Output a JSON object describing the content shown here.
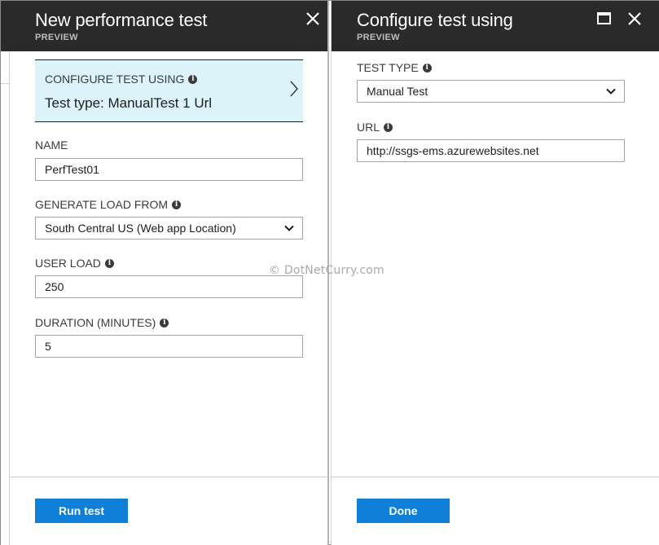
{
  "left_blade": {
    "title": "New performance test",
    "subtitle": "PREVIEW",
    "configure": {
      "label": "CONFIGURE TEST USING",
      "value": "Test type: ManualTest 1 Url"
    },
    "name": {
      "label": "NAME",
      "value": "PerfTest01"
    },
    "load_from": {
      "label": "GENERATE LOAD FROM",
      "value": "South Central US (Web app Location)"
    },
    "user_load": {
      "label": "USER LOAD",
      "value": "250"
    },
    "duration": {
      "label": "DURATION (MINUTES)",
      "value": "5"
    },
    "run_button": "Run test"
  },
  "right_blade": {
    "title": "Configure test using",
    "subtitle": "PREVIEW",
    "test_type": {
      "label": "TEST TYPE",
      "value": "Manual Test"
    },
    "url": {
      "label": "URL",
      "value": "http://ssgs-ems.azurewebsites.net"
    },
    "done_button": "Done"
  },
  "watermark": "© DotNetCurry.com",
  "colors": {
    "header_bg": "#2a2a2a",
    "accent_blue": "#0f7fd8",
    "selected_card_bg": "#dcf3fa"
  },
  "icons": {
    "close": "close-icon",
    "maximize": "maximize-icon",
    "info": "info-icon",
    "chevron_down": "chevron-down-icon",
    "chevron_right": "chevron-right-icon"
  }
}
